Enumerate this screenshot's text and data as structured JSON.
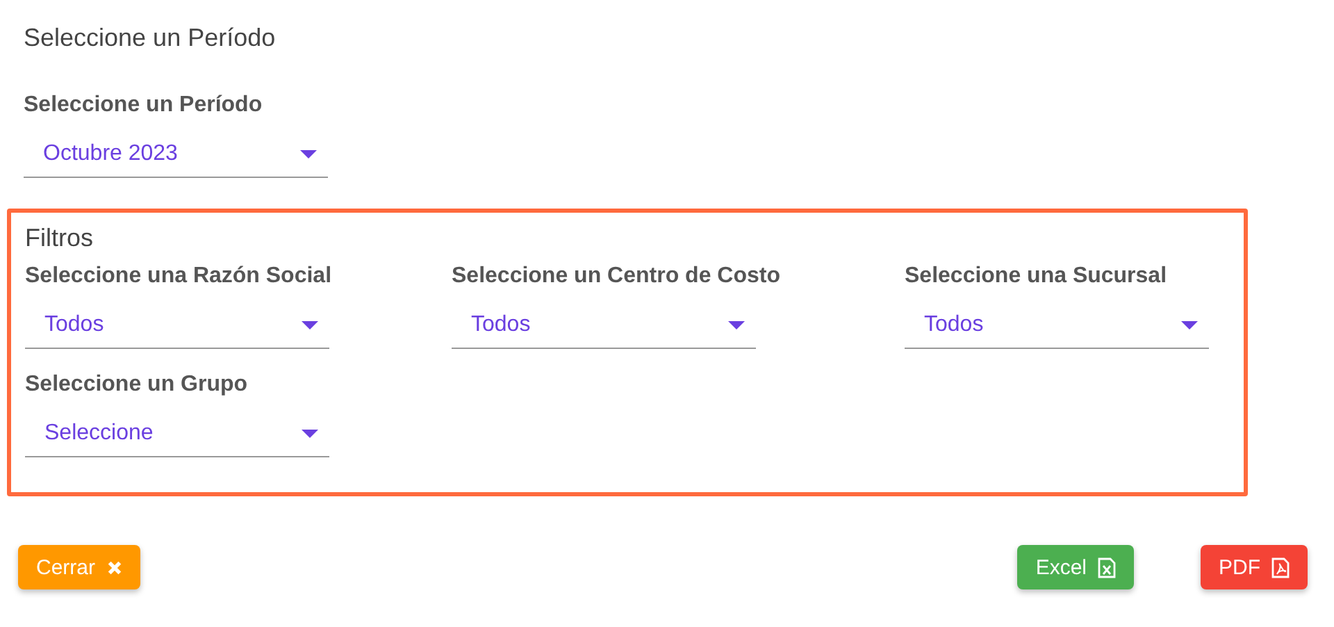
{
  "title": "Seleccione un Período",
  "period": {
    "label": "Seleccione un Período",
    "value": "Octubre 2023"
  },
  "filters": {
    "title": "Filtros",
    "selects": [
      {
        "label": "Seleccione una Razón Social",
        "value": "Todos"
      },
      {
        "label": "Seleccione un Centro de Costo",
        "value": "Todos"
      },
      {
        "label": "Seleccione una Sucursal",
        "value": "Todos"
      },
      {
        "label": "Seleccione un Grupo",
        "value": "Seleccione"
      }
    ]
  },
  "buttons": [
    {
      "label": "Cerrar",
      "kind": "close"
    },
    {
      "label": "Excel",
      "kind": "excel"
    },
    {
      "label": "PDF",
      "kind": "pdf"
    }
  ]
}
